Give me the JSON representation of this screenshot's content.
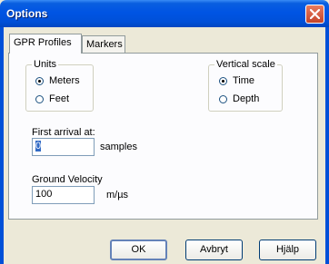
{
  "window": {
    "title": "Options"
  },
  "tabs": [
    {
      "label": "GPR Profiles",
      "active": true
    },
    {
      "label": "Markers",
      "active": false
    }
  ],
  "units": {
    "legend": "Units",
    "options": [
      {
        "label": "Meters",
        "checked": true
      },
      {
        "label": "Feet",
        "checked": false
      }
    ]
  },
  "vertical_scale": {
    "legend": "Vertical scale",
    "options": [
      {
        "label": "Time",
        "checked": true
      },
      {
        "label": "Depth",
        "checked": false
      }
    ]
  },
  "first_arrival": {
    "label": "First arrival at:",
    "value": "0",
    "unit": "samples"
  },
  "ground_velocity": {
    "label": "Ground Velocity",
    "value": "100",
    "unit": "m/µs"
  },
  "buttons": {
    "ok": "OK",
    "cancel": "Avbryt",
    "help": "Hjälp"
  },
  "icons": {
    "close": "close-icon"
  }
}
